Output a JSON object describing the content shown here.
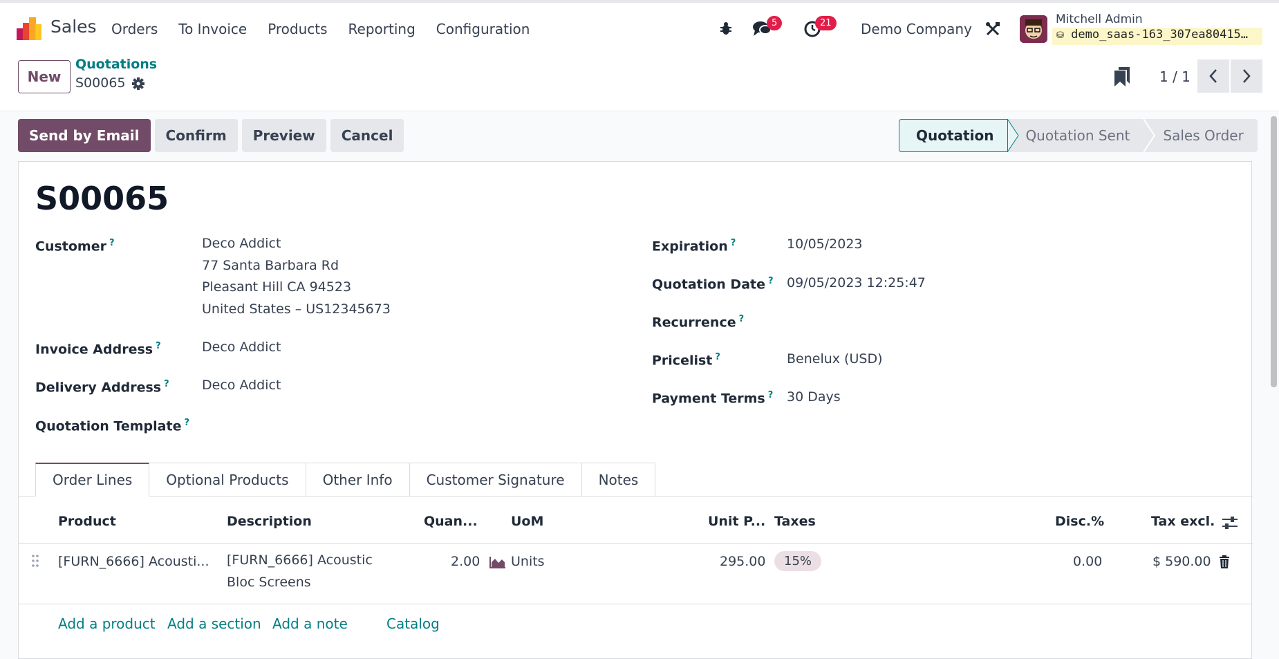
{
  "navbar": {
    "app_name": "Sales",
    "menu": [
      "Orders",
      "To Invoice",
      "Products",
      "Reporting",
      "Configuration"
    ],
    "messages_count": "5",
    "activities_count": "21",
    "company": "Demo Company",
    "user_name": "Mitchell Admin",
    "db_name": "demo_saas-163_307ea80415…"
  },
  "control": {
    "new_label": "New",
    "breadcrumb_parent": "Quotations",
    "breadcrumb_current": "S00065",
    "pager": "1 / 1"
  },
  "actions": {
    "send_email": "Send by Email",
    "confirm": "Confirm",
    "preview": "Preview",
    "cancel": "Cancel"
  },
  "statusbar": [
    "Quotation",
    "Quotation Sent",
    "Sales Order"
  ],
  "form": {
    "title": "S00065",
    "customer_label": "Customer",
    "customer_lines": [
      "Deco Addict",
      "77 Santa Barbara Rd",
      "Pleasant Hill CA 94523",
      "United States – US12345673"
    ],
    "invoice_label": "Invoice Address",
    "invoice_value": "Deco Addict",
    "delivery_label": "Delivery Address",
    "delivery_value": "Deco Addict",
    "template_label": "Quotation Template",
    "expiration_label": "Expiration",
    "expiration_value": "10/05/2023",
    "qdate_label": "Quotation Date",
    "qdate_value": "09/05/2023 12:25:47",
    "recurrence_label": "Recurrence",
    "pricelist_label": "Pricelist",
    "pricelist_value": "Benelux (USD)",
    "terms_label": "Payment Terms",
    "terms_value": "30 Days"
  },
  "tabs": [
    "Order Lines",
    "Optional Products",
    "Other Info",
    "Customer Signature",
    "Notes"
  ],
  "table": {
    "headers": {
      "product": "Product",
      "description": "Description",
      "quantity": "Quan...",
      "uom": "UoM",
      "unit_price": "Unit P...",
      "taxes": "Taxes",
      "discount": "Disc.%",
      "subtotal": "Tax excl."
    },
    "rows": [
      {
        "product": "[FURN_6666] Acousti...",
        "description_1": "[FURN_6666] Acoustic",
        "description_2": "Bloc Screens",
        "quantity": "2.00",
        "uom": "Units",
        "unit_price": "295.00",
        "tax": "15%",
        "discount": "0.00",
        "subtotal": "$ 590.00"
      }
    ],
    "add_product": "Add a product",
    "add_section": "Add a section",
    "add_note": "Add a note",
    "catalog": "Catalog"
  }
}
